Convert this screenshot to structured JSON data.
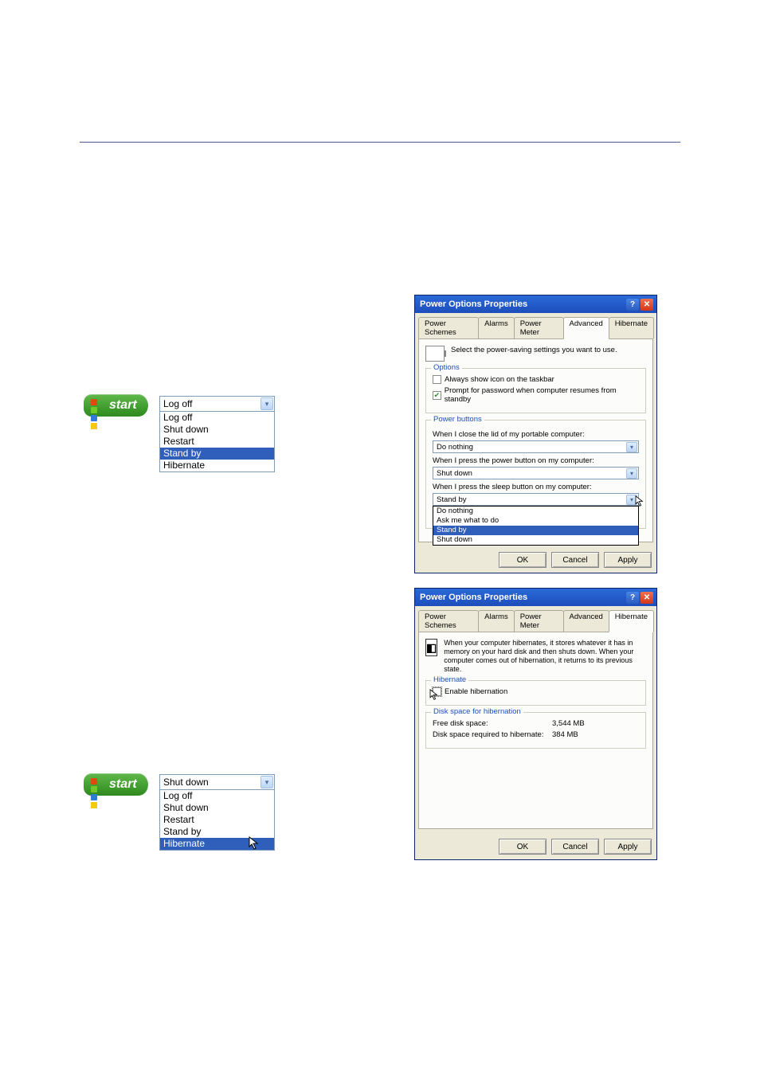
{
  "start_label": "start",
  "standby_combo": {
    "selected": "Log off",
    "items": [
      "Log off",
      "Shut down",
      "Restart",
      "Stand by",
      "Hibernate"
    ],
    "highlight_index": 3
  },
  "hibernate_combo": {
    "selected": "Shut down",
    "items": [
      "Log off",
      "Shut down",
      "Restart",
      "Stand by",
      "Hibernate"
    ],
    "highlight_index": 4
  },
  "dialog_title": "Power Options Properties",
  "tabs": [
    "Power Schemes",
    "Alarms",
    "Power Meter",
    "Advanced",
    "Hibernate"
  ],
  "advanced": {
    "desc": "Select the power-saving settings you want to use.",
    "options_label": "Options",
    "chk_taskbar": "Always show icon on the taskbar",
    "chk_pwd": "Prompt for password when computer resumes from standby",
    "power_buttons_label": "Power buttons",
    "lid_label": "When I close the lid of my portable computer:",
    "lid_value": "Do nothing",
    "pwr_label": "When I press the power button on my computer:",
    "pwr_value": "Shut down",
    "sleep_label": "When I press the sleep button on my computer:",
    "sleep_value": "Stand by",
    "sleep_menu": [
      "Do nothing",
      "Ask me what to do",
      "Stand by",
      "Shut down"
    ],
    "sleep_hl": 2
  },
  "hibernate_tab": {
    "desc": "When your computer hibernates, it stores whatever it has in memory on your hard disk and then shuts down. When your computer comes out of hibernation, it returns to its previous state.",
    "group_label": "Hibernate",
    "enable_label": "Enable hibernation",
    "disk_group": "Disk space for hibernation",
    "free_label": "Free disk space:",
    "free_val": "3,544 MB",
    "req_label": "Disk space required to hibernate:",
    "req_val": "384 MB"
  },
  "buttons": {
    "ok": "OK",
    "cancel": "Cancel",
    "apply": "Apply"
  }
}
